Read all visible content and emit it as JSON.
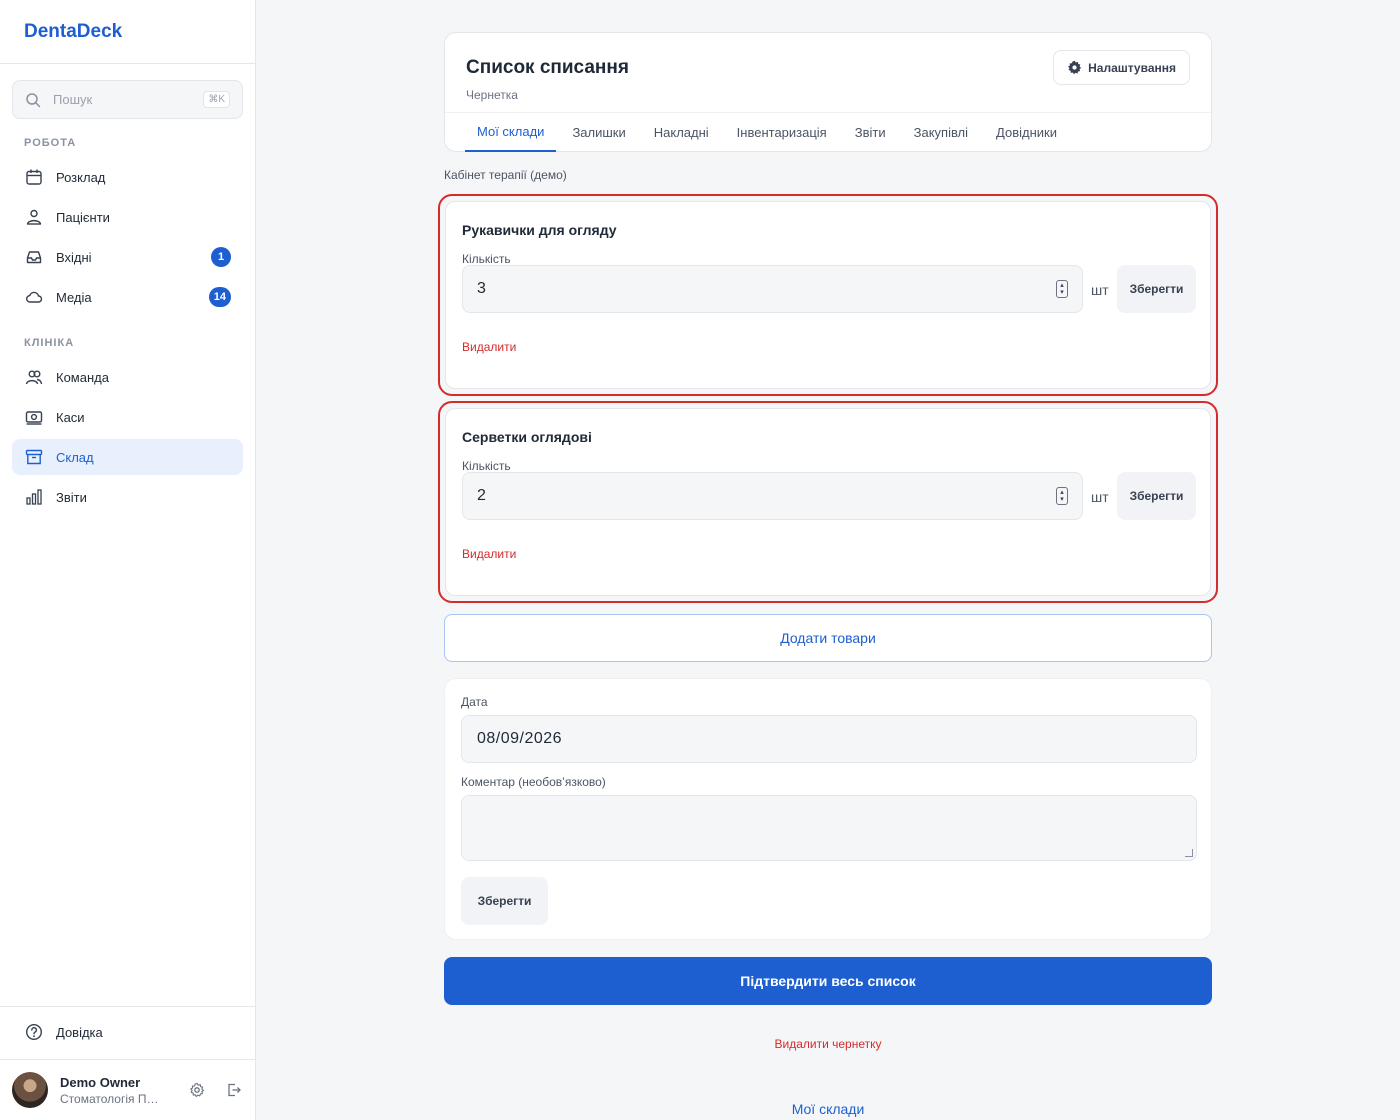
{
  "brand": "DentaDeck",
  "search": {
    "placeholder": "Пошук",
    "shortcut": "⌘K"
  },
  "sidebar": {
    "sections": [
      {
        "label": "РОБОТА"
      },
      {
        "label": "КЛІНІКА"
      }
    ],
    "items": [
      {
        "label": "Розклад",
        "icon": "calendar-icon"
      },
      {
        "label": "Пацієнти",
        "icon": "patients-icon"
      },
      {
        "label": "Вхідні",
        "icon": "inbox-icon",
        "badge": "1"
      },
      {
        "label": "Медіа",
        "icon": "cloud-icon",
        "badge": "14"
      },
      {
        "label": "Команда",
        "icon": "team-icon"
      },
      {
        "label": "Каси",
        "icon": "cash-icon"
      },
      {
        "label": "Склад",
        "icon": "archive-icon",
        "active": true
      },
      {
        "label": "Звіти",
        "icon": "bar-chart-icon"
      }
    ],
    "help": "Довідка",
    "user": {
      "name": "Demo Owner",
      "org": "Стоматологія Пе..."
    }
  },
  "header": {
    "title": "Список списання",
    "subtitle": "Чернетка",
    "settings_label": "Налаштування",
    "tabs": [
      {
        "label": "Мої склади",
        "active": true
      },
      {
        "label": "Залишки"
      },
      {
        "label": "Накладні"
      },
      {
        "label": "Інвентаризація"
      },
      {
        "label": "Звіти"
      },
      {
        "label": "Закупівлі"
      },
      {
        "label": "Довідники"
      }
    ]
  },
  "location": "Кабінет терапії (демо)",
  "items": [
    {
      "name": "Рукавички для огляду",
      "qty_label": "Кількість",
      "qty": "3",
      "unit": "шт",
      "save_label": "Зберегти",
      "delete_label": "Видалити"
    },
    {
      "name": "Серветки оглядові",
      "qty_label": "Кількість",
      "qty": "2",
      "unit": "шт",
      "save_label": "Зберегти",
      "delete_label": "Видалити"
    }
  ],
  "add_items_label": "Додати товари",
  "form": {
    "date_label": "Дата",
    "date_value": "08/09/2026",
    "comment_label": "Коментар (необов’язково)",
    "comment_value": "",
    "save_label": "Зберегти"
  },
  "confirm_label": "Підтвердити весь список",
  "delete_draft_label": "Видалити чернетку",
  "footer_link": "Мої склади",
  "colors": {
    "accent": "#1d5fd0",
    "danger": "#d72a2a"
  }
}
